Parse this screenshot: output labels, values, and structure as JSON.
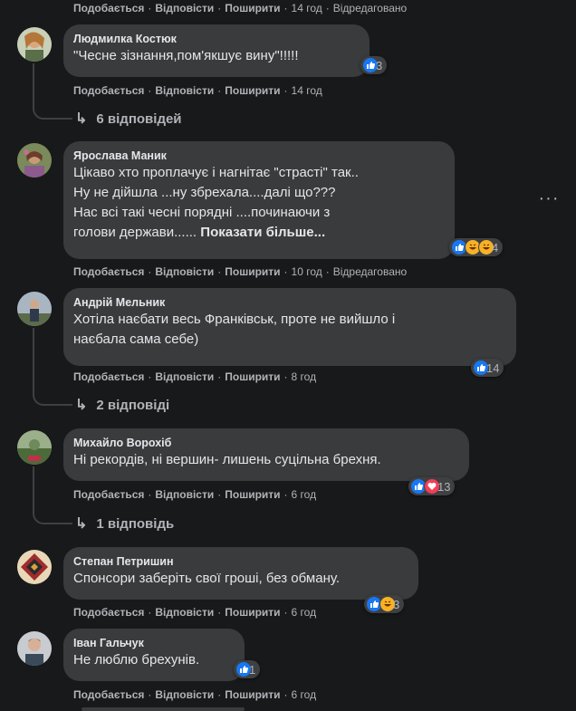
{
  "actions": {
    "like": "Подобається",
    "reply": "Відповісти",
    "share": "Поширити",
    "edited": "Відредаговано"
  },
  "top_meta": {
    "time": "14 год"
  },
  "comments": [
    {
      "name": "Людмилка Костюк",
      "text": "\"Чесне зізнання,пом'якшує вину\"!!!!!",
      "reactions": [
        "like"
      ],
      "count": "3",
      "time": "14 год",
      "replies": "6 відповідей"
    },
    {
      "name": "Ярослава Маник",
      "text": "Цікаво хто проплачує і нагнітає \"страсті\" так..\nНу не дійшла ...ну збрехала....далі що???\nНас всі такі чесні порядні ....починаючи з\nголови держави...... ",
      "more": "Показати більше...",
      "reactions": [
        "like",
        "haha",
        "haha"
      ],
      "count": "4",
      "time": "10 год"
    },
    {
      "name": "Андрій Мельник",
      "text": "Хотіла наєбати весь Франківськ, проте не вийшло і\nнаєбала сама себе)",
      "reactions": [
        "like"
      ],
      "count": "14",
      "time": "8 год",
      "replies": "2 відповіді"
    },
    {
      "name": "Михайло Ворохіб",
      "text": "Ні рекордів, ні вершин- лишень суцільна брехня.",
      "reactions": [
        "like",
        "love"
      ],
      "count": "13",
      "time": "6 год",
      "replies": "1 відповідь"
    },
    {
      "name": "Степан Петришин",
      "text": "Спонсори заберіть свої гроші, без обману.",
      "reactions": [
        "like",
        "haha"
      ],
      "count": "3",
      "time": "6 год"
    },
    {
      "name": "Іван Гальчук",
      "text": "Не люблю брехунів.",
      "reactions": [
        "like"
      ],
      "count": "1",
      "time": "6 год"
    }
  ],
  "icons": {
    "reply_arrow": "reply-arrow-icon",
    "more": "more-options-icon",
    "like": "like-reaction-icon",
    "love": "love-reaction-icon",
    "haha": "haha-reaction-icon"
  },
  "colors": {
    "background": "#18191a",
    "bubble": "#3a3b3c",
    "like": "#1877f2",
    "love": "#f33e58",
    "haha": "#f7b125"
  }
}
